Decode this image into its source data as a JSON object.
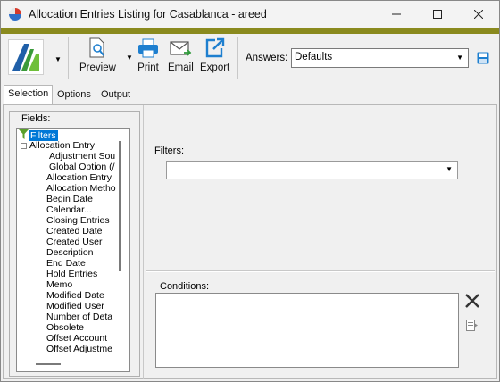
{
  "window": {
    "title": "Allocation Entries Listing for Casablanca - areed"
  },
  "toolbar": {
    "preview_label": "Preview",
    "print_label": "Print",
    "email_label": "Email",
    "export_label": "Export",
    "answers_label": "Answers:",
    "answers_value": "Defaults"
  },
  "tabs": [
    {
      "label": "Selection",
      "active": true
    },
    {
      "label": "Options",
      "active": false
    },
    {
      "label": "Output",
      "active": false
    }
  ],
  "fields": {
    "label": "Fields:",
    "root": "Filters",
    "group": "Allocation Entry",
    "items": [
      "Adjustment Sou",
      "Global Option (/",
      "Allocation Entry",
      "Allocation Metho",
      "Begin Date",
      "Calendar...",
      "Closing Entries",
      "Created Date",
      "Created User",
      "Description",
      "End Date",
      "Hold Entries",
      "Memo",
      "Modified Date",
      "Modified User",
      "Number of Deta",
      "Obsolete",
      "Offset Account",
      "Offset Adjustme"
    ]
  },
  "filters": {
    "label": "Filters:",
    "value": ""
  },
  "conditions": {
    "label": "Conditions:"
  },
  "colors": {
    "accent_bar": "#8a8a1e",
    "selection": "#0078d7",
    "icon_blue": "#1e7fcf"
  }
}
